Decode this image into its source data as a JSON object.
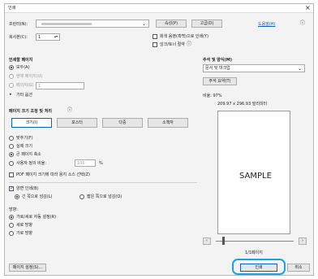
{
  "window": {
    "title": "인쇄",
    "close": "×"
  },
  "printer": {
    "label": "프린터(N):",
    "value": "",
    "properties_btn": "속성(P)",
    "advanced_btn": "고급(D)",
    "help_link": "도움말(H)"
  },
  "copies": {
    "label": "복사본(C):",
    "value": "1"
  },
  "options": {
    "grayscale": "회색 음영(흑백)으로 인쇄(Y)",
    "save_ink": "잉크/토너 절약"
  },
  "pages": {
    "heading": "인쇄할 페이지",
    "all": "모두(A)",
    "current": "현재 페이지(U)",
    "range": "페이지(G)",
    "range_value": "1",
    "more": "기타 옵션"
  },
  "sizing": {
    "heading": "페이지 크기 조정 및 처리",
    "tabs": [
      "크기(I)",
      "포스터",
      "다중",
      "소책자"
    ],
    "fit": "맞추기(F)",
    "actual": "실제 크기",
    "shrink": "큰 페이지 축소",
    "custom": "사용자 정의 비율:",
    "custom_value": "100",
    "percent": "%",
    "pdf_source": "PDF 페이지 크기에 따라 용지 소스 선택(Z)"
  },
  "duplex": {
    "label": "양면 인쇄(B)",
    "long": "긴 쪽으로 넘김(L)",
    "short": "짧은 쪽으로 넘김(O)"
  },
  "orientation": {
    "heading": "방향:",
    "auto": "가로/세로 자동 설정(R)",
    "portrait": "세로 방향",
    "landscape": "가로 방향"
  },
  "comments": {
    "heading": "주석 및 양식(M)",
    "value": "문서 및 마크업",
    "summary_btn": "주석 요약(T)",
    "scale": "비율: 97%",
    "paper_size": "209.97 x 296.93 밀리미터",
    "preview_text": "SAMPLE",
    "page_count": "1/1페이지"
  },
  "footer": {
    "page_setup": "페이지 설정(S)...",
    "print": "인쇄",
    "cancel": "취소"
  },
  "colors": {
    "highlight": "#1aa3e0",
    "link": "#1a5fb4"
  }
}
